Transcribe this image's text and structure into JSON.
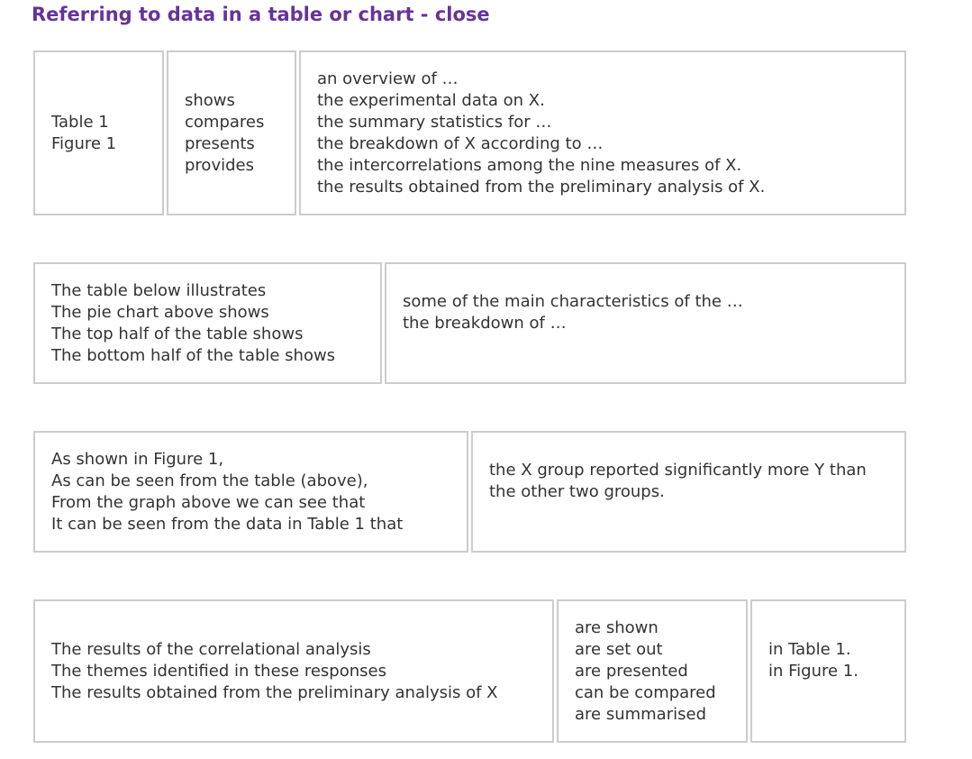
{
  "title": "Referring to data in a table or chart - close",
  "rows": [
    {
      "cells": [
        {
          "lines": [
            "Table 1",
            "Figure 1"
          ]
        },
        {
          "lines": [
            "shows",
            "compares",
            "presents",
            "provides"
          ]
        },
        {
          "lines": [
            "an overview of …",
            "the experimental data on X.",
            "the summary statistics for …",
            "the breakdown of X according to …",
            "the intercorrelations among the nine measures of X.",
            "the results obtained from the preliminary analysis of X."
          ]
        }
      ]
    },
    {
      "cells": [
        {
          "lines": [
            "The table below illustrates",
            "The pie chart above shows",
            "The top half of the table shows",
            "The bottom half of the table shows"
          ]
        },
        {
          "lines": [
            "some of the main characteristics of the …",
            "the breakdown of …"
          ]
        }
      ]
    },
    {
      "cells": [
        {
          "lines": [
            "As shown in Figure 1,",
            "As can be seen from the table (above),",
            "From the graph above we can see that",
            "It can be seen from the data in Table 1 that"
          ]
        },
        {
          "lines": [
            "the X group reported significantly more Y than",
            "the other two groups."
          ]
        }
      ]
    },
    {
      "cells": [
        {
          "lines": [
            "The results of the correlational analysis",
            "The themes identified in these responses",
            "The results obtained from the preliminary analysis of X"
          ]
        },
        {
          "lines": [
            "are shown",
            "are set out",
            "are presented",
            "can be compared",
            "are summarised"
          ]
        },
        {
          "lines": [
            "in Table 1.",
            "in Figure 1."
          ]
        }
      ]
    }
  ]
}
